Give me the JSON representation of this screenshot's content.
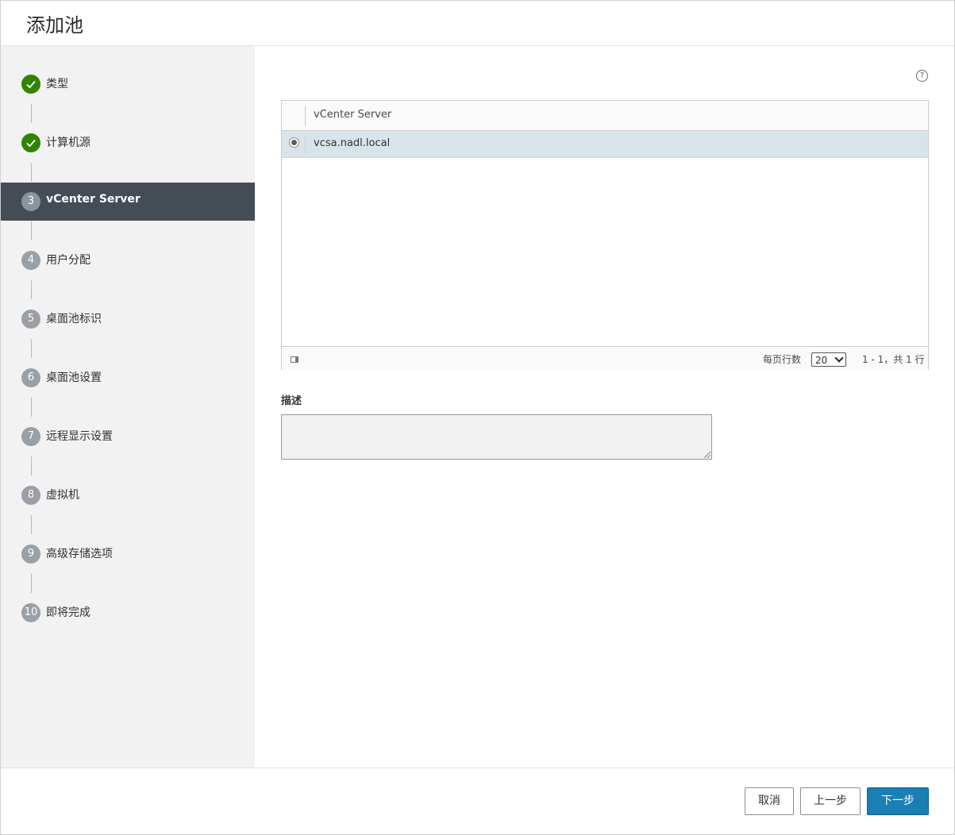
{
  "dialog": {
    "title": "添加池"
  },
  "wizard": {
    "steps": [
      {
        "number": "1",
        "label": "类型",
        "status": "done"
      },
      {
        "number": "2",
        "label": "计算机源",
        "status": "done"
      },
      {
        "number": "3",
        "label": "vCenter Server",
        "status": "current"
      },
      {
        "number": "4",
        "label": "用户分配",
        "status": "pending"
      },
      {
        "number": "5",
        "label": "桌面池标识",
        "status": "pending"
      },
      {
        "number": "6",
        "label": "桌面池设置",
        "status": "pending"
      },
      {
        "number": "7",
        "label": "远程显示设置",
        "status": "pending"
      },
      {
        "number": "8",
        "label": "虚拟机",
        "status": "pending"
      },
      {
        "number": "9",
        "label": "高级存储选项",
        "status": "pending"
      },
      {
        "number": "10",
        "label": "即将完成",
        "status": "pending"
      }
    ]
  },
  "help": {
    "icon": "help-icon",
    "glyph": "?"
  },
  "grid": {
    "column_header": "vCenter Server",
    "rows": [
      {
        "value": "vcsa.nadl.local",
        "selected": true
      }
    ],
    "footer": {
      "per_page_label": "每页行数",
      "per_page_value": "20",
      "range_text": "1 - 1，共 1 行"
    }
  },
  "description": {
    "label": "描述",
    "value": ""
  },
  "buttons": {
    "cancel": "取消",
    "prev": "上一步",
    "next": "下一步"
  },
  "colors": {
    "accent": "#1a7fb4",
    "done": "#2f8400",
    "active_step_bg": "#444c56",
    "selected_row": "#d9e4ea"
  }
}
